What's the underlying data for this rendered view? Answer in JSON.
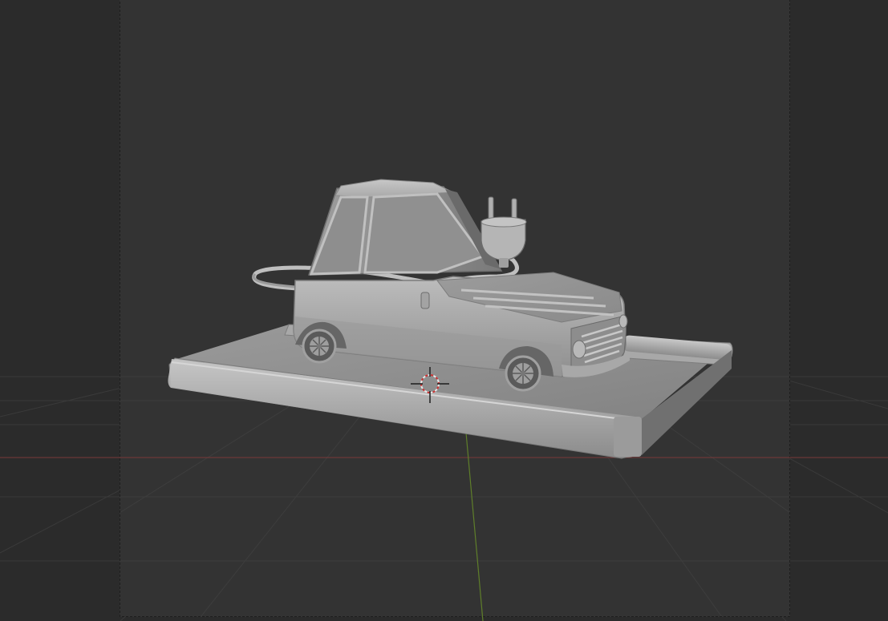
{
  "app": "Blender",
  "viewport": {
    "mode": "camera-view",
    "shading": "solid"
  },
  "scene": {
    "objects": [
      {
        "name": "car",
        "icon": "car-icon"
      },
      {
        "name": "plug",
        "icon": "plug-icon"
      },
      {
        "name": "cable",
        "icon": "cable-icon"
      },
      {
        "name": "road-base",
        "icon": "road-icon"
      }
    ]
  },
  "gizmos": {
    "cursor": "3d-cursor-icon",
    "x_axis_color": "#8b3b3b",
    "y_axis_color": "#6b8e23"
  },
  "colors": {
    "outside_bg": "#2b2b2b",
    "camera_bg": "#333333",
    "grid": "#3d3d3d",
    "model_light": "#b9b9b9",
    "model_mid": "#8f8f8f",
    "model_dark": "#555555"
  }
}
